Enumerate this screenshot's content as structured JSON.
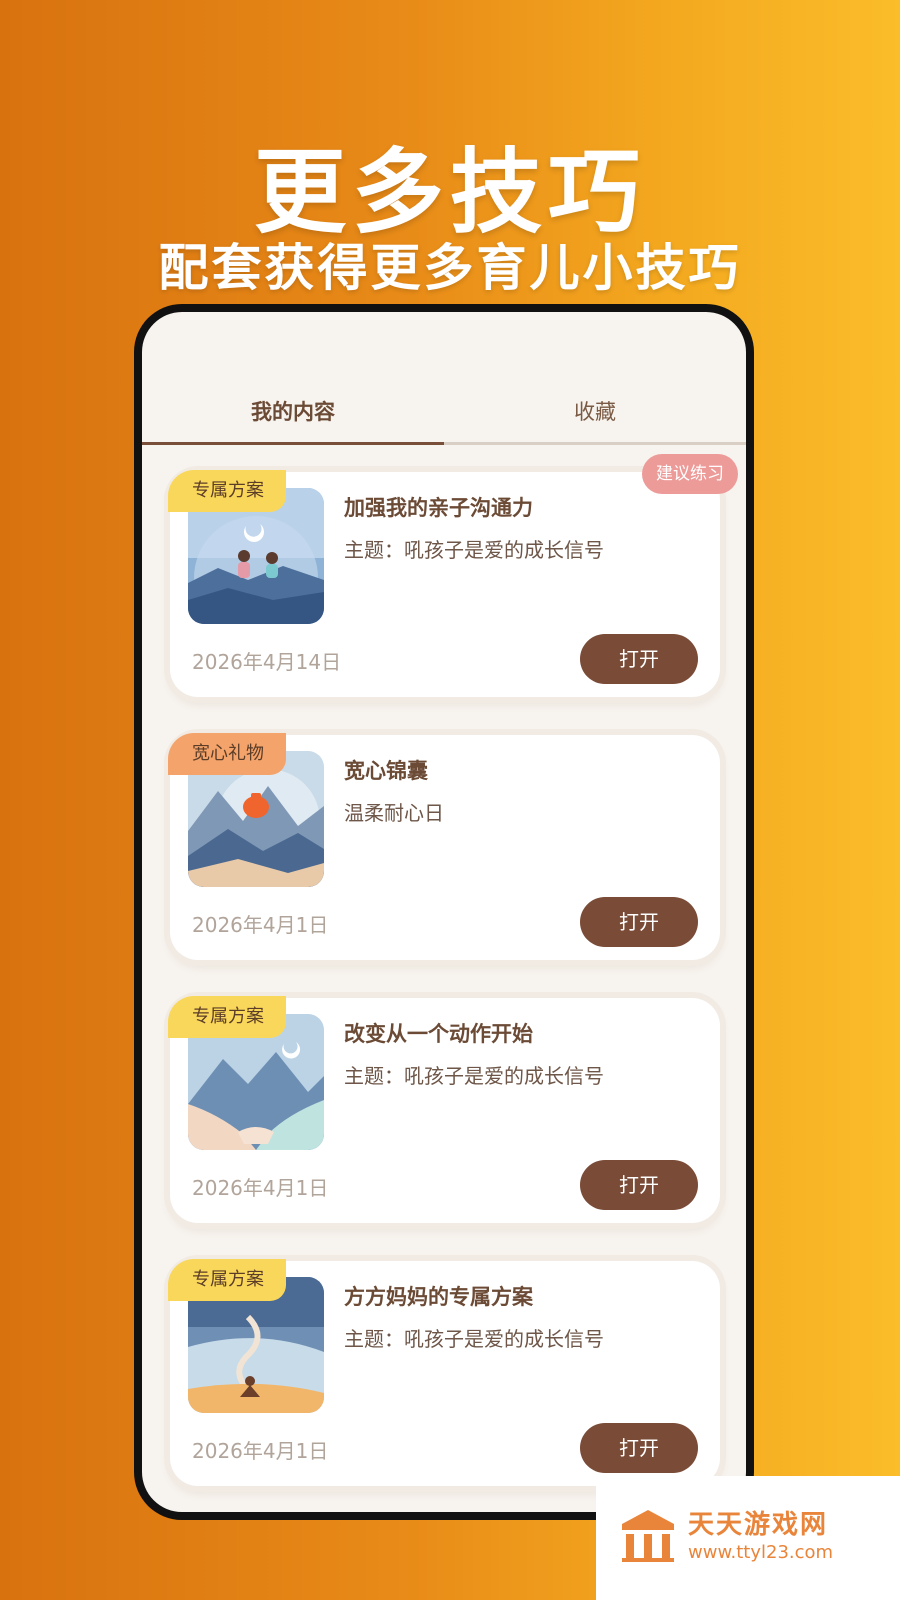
{
  "banner": {
    "headline": "更多技巧",
    "subline": "配套获得更多育儿小技巧"
  },
  "tabs": [
    {
      "label": "我的内容",
      "active": true
    },
    {
      "label": "收藏",
      "active": false
    }
  ],
  "cards": [
    {
      "tag": "专属方案",
      "title": "加强我的亲子沟通力",
      "subtitle": "主题：吼孩子是爱的成长信号",
      "date": "2026年4月14日",
      "button": "打开",
      "badge": "建议练习"
    },
    {
      "tag": "宽心礼物",
      "title": "宽心锦囊",
      "subtitle": "温柔耐心日",
      "date": "2026年4月1日",
      "button": "打开"
    },
    {
      "tag": "专属方案",
      "title": "改变从一个动作开始",
      "subtitle": "主题：吼孩子是爱的成长信号",
      "date": "2026年4月1日",
      "button": "打开"
    },
    {
      "tag": "专属方案",
      "title": "方方妈妈的专属方案",
      "subtitle": "主题：吼孩子是爱的成长信号",
      "date": "2026年4月1日",
      "button": "打开"
    }
  ],
  "watermark": {
    "name": "天天游戏网",
    "url": "www.ttyl23.com"
  },
  "colors": {
    "accent_brown": "#7a4b37",
    "badge_pink": "#ec9b99",
    "tag_yellow": "#f9d75a",
    "tag_orange": "#f4a46b"
  }
}
